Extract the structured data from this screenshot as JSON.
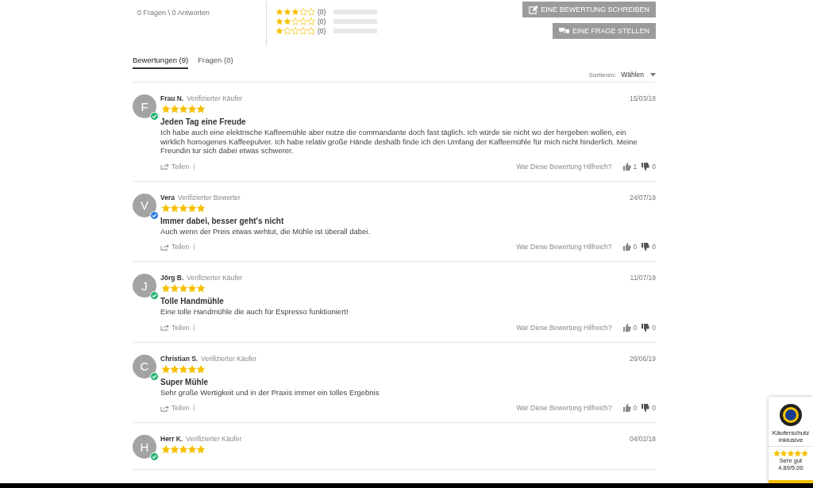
{
  "summary": {
    "qa_count": "0 Fragen \\ 0 Antworten",
    "distribution": [
      {
        "stars": 3,
        "count": "(0)",
        "level": 0
      },
      {
        "stars": 2,
        "count": "(0)",
        "level": 0
      },
      {
        "stars": 1,
        "count": "(0)",
        "level": 0
      }
    ],
    "buttons": [
      {
        "kind": "write",
        "label": "EINE BEWERTUNG SCHREIBEN"
      },
      {
        "kind": "ask",
        "label": "EINE FRAGE STELLEN"
      }
    ]
  },
  "tabs": [
    {
      "label": "Bewertungen (9)",
      "selected": true
    },
    {
      "label": "Fragen (0)",
      "selected": false
    }
  ],
  "sort": {
    "label": "Sortieren:",
    "value": "Wählen"
  },
  "reviews": [
    {
      "initial": "F",
      "author": "Frau N.",
      "verified": "Verifizierter Käufer",
      "color": "#2bb673",
      "date": "15/03/18",
      "stars": 5,
      "title": "Jeden Tag eine Freude",
      "body": "Ich habe auch eine elektrische Kaffeemühle aber nutze die commandante doch fast täglich. Ich würde sie nicht wo der hergeben wollen, ein wirklich homogenes Kaffeepulver. Ich habe relativ große Hände deshalb finde ich den Umfang der Kaffeemühle für mich nicht hinderlich. Meine Freundin tur sich dabei etwas schwerer.",
      "share": "Teilen",
      "helpful": "War Diese Bewertung Hilfreich?",
      "up": "1",
      "down": "0"
    },
    {
      "initial": "V",
      "author": "Vera",
      "verified": "Verifizierter Bewerter",
      "color": "#2f7de1",
      "date": "24/07/19",
      "stars": 5,
      "title": "Immer dabei, besser geht's nicht",
      "body": "Auch wenn der Preis etwas wehtut, die Mühle ist überall dabei.",
      "share": "Teilen",
      "helpful": "War Diese Bewertung Hilfreich?",
      "up": "0",
      "down": "0"
    },
    {
      "initial": "J",
      "author": "Jörg B.",
      "verified": "Verifizierter Käufer",
      "color": "#2bb673",
      "date": "11/07/19",
      "stars": 5,
      "title": "Tolle Handmühle",
      "body": "Eine tolle Handmühle die auch für Espresso funktioniert!",
      "share": "Teilen",
      "helpful": "War Diese Bewertung Hilfreich?",
      "up": "0",
      "down": "0"
    },
    {
      "initial": "C",
      "author": "Christian S.",
      "verified": "Verifizierter Käufer",
      "color": "#2bb673",
      "date": "26/06/19",
      "stars": 5,
      "title": "Super Mühle",
      "body": "Sehr große Wertigkeit und in der Praxis immer ein tolles Ergebnis",
      "share": "Teilen",
      "helpful": "War Diese Bewertung Hilfreich?",
      "up": "0",
      "down": "0"
    },
    {
      "initial": "H",
      "author": "Herr K.",
      "verified": "Verifizierter Käufer",
      "color": "#2bb673",
      "date": "04/02/18",
      "stars": 5
    }
  ],
  "trust_badge": {
    "label": "Käuferschutz inklusive",
    "stars": 5,
    "grade": "Sehr gut",
    "score": "4.89/5.00"
  }
}
